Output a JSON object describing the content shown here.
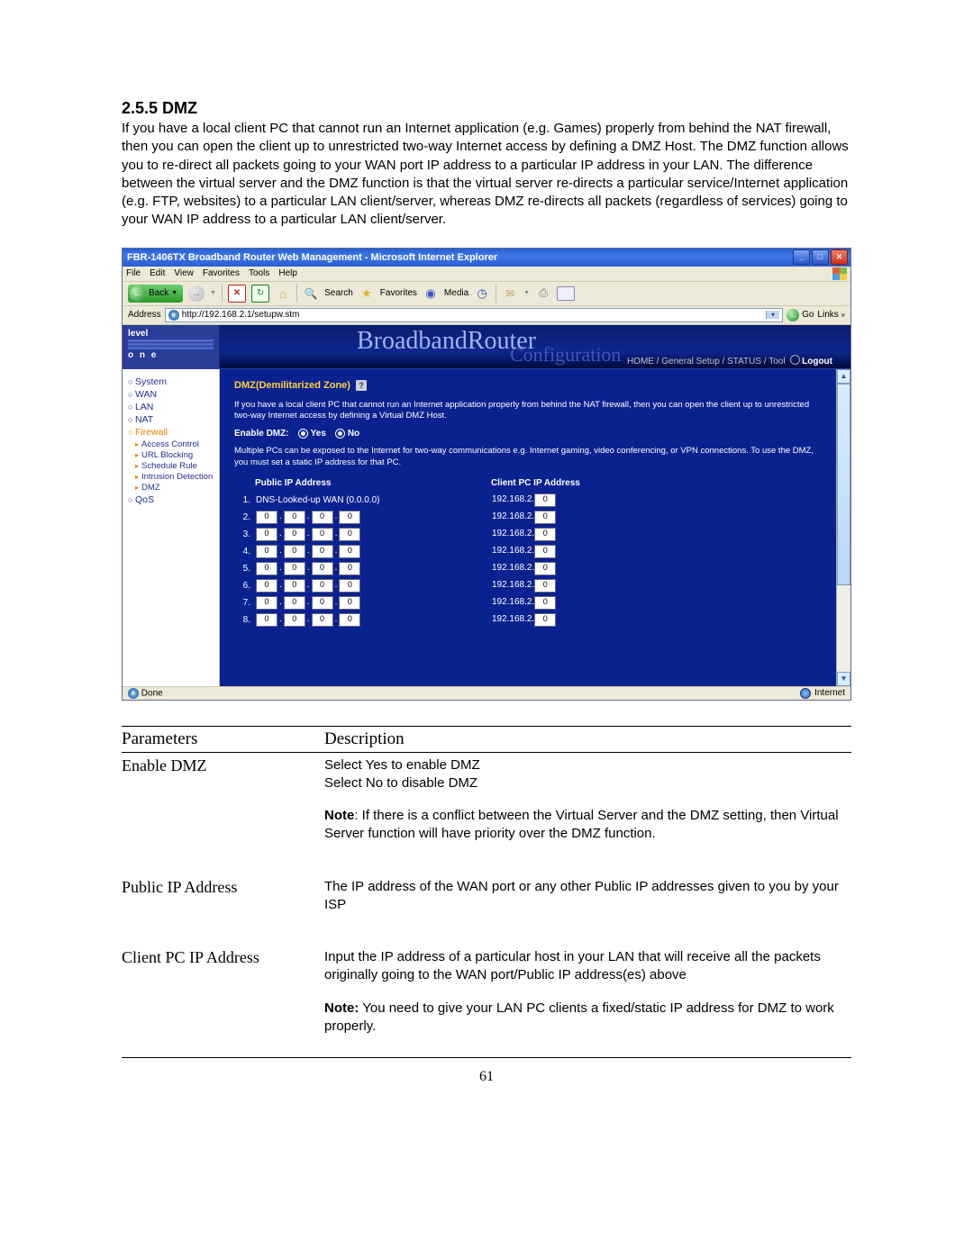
{
  "heading": "2.5.5 DMZ",
  "intro": "If you have a local client PC that cannot run an Internet application (e.g. Games) properly from behind the NAT firewall, then you can open the client up to unrestricted two-way Internet access by defining a DMZ Host. The DMZ function allows you to re-direct all packets going to your WAN port IP address to a particular IP address in your LAN. The difference between the virtual server and the DMZ function is that the virtual server re-directs a particular service/Internet application (e.g. FTP, websites) to a particular LAN client/server, whereas DMZ re-directs all packets (regardless of services) going to your WAN IP address to a particular LAN client/server.",
  "browser": {
    "title": "FBR-1406TX Broadband Router Web Management - Microsoft Internet Explorer",
    "menus": [
      "File",
      "Edit",
      "View",
      "Favorites",
      "Tools",
      "Help"
    ],
    "toolbar": {
      "back": "Back",
      "search": "Search",
      "favorites": "Favorites",
      "media": "Media"
    },
    "address_label": "Address",
    "url": "http://192.168.2.1/setupw.stm",
    "go": "Go",
    "links": "Links",
    "status_done": "Done",
    "status_zone": "Internet"
  },
  "banner": {
    "logo_top": "level",
    "logo_bottom": "o n e",
    "title": "BroadbandRouter",
    "subtitle": "Configuration",
    "breadcrumb": "HOME / General Setup / STATUS / Tool",
    "logout": "Logout"
  },
  "sidebar": {
    "items": [
      {
        "label": "System"
      },
      {
        "label": "WAN"
      },
      {
        "label": "LAN"
      },
      {
        "label": "NAT"
      },
      {
        "label": "Firewall",
        "active": true
      },
      {
        "label": "QoS"
      }
    ],
    "sub": [
      "Access Control",
      "URL Blocking",
      "Schedule Rule",
      "Intrusion Detection",
      "DMZ"
    ]
  },
  "dmz": {
    "title": "DMZ(Demilitarized Zone)",
    "desc": "If you have a local client PC that cannot run an Internet application properly from behind the NAT firewall, then you can open the client up to unrestricted two-way Internet access by defining a Virtual DMZ Host.",
    "enable_label": "Enable DMZ:",
    "yes": "Yes",
    "no": "No",
    "note": "Multiple PCs can be exposed to the Internet for two-way communications e.g. Internet gaming, video conferencing, or VPN connections.  To use the DMZ, you must set a static IP address for that PC.",
    "th_public": "Public IP Address",
    "th_client": "Client PC IP Address",
    "row1_public": "DNS-Looked-up WAN (0.0.0.0)",
    "client_prefix": "192.168.2.",
    "client_last": "0",
    "rows": [
      {
        "n": "1.",
        "first": true
      },
      {
        "n": "2.",
        "oct": [
          "0",
          "0",
          "0",
          "0"
        ]
      },
      {
        "n": "3.",
        "oct": [
          "0",
          "0",
          "0",
          "0"
        ]
      },
      {
        "n": "4.",
        "oct": [
          "0",
          "0",
          "0",
          "0"
        ]
      },
      {
        "n": "5.",
        "oct": [
          "0",
          "0",
          "0",
          "0"
        ]
      },
      {
        "n": "6.",
        "oct": [
          "0",
          "0",
          "0",
          "0"
        ]
      },
      {
        "n": "7.",
        "oct": [
          "0",
          "0",
          "0",
          "0"
        ]
      },
      {
        "n": "8.",
        "oct": [
          "0",
          "0",
          "0",
          "0"
        ]
      }
    ]
  },
  "params": {
    "h1": "Parameters",
    "h2": "Description",
    "rows": [
      {
        "name": "Enable DMZ",
        "p1": "Select Yes to enable DMZ\nSelect No to disable DMZ",
        "p2_label": "Note",
        "p2": ": If there is a conflict between the Virtual Server and the DMZ setting, then Virtual Server function will have priority over the DMZ function."
      },
      {
        "name": "Public IP Address",
        "p1": "The IP address of the WAN port or any other Public IP addresses given to you by your ISP"
      },
      {
        "name": "Client PC IP Address",
        "p1": "Input the IP address of a particular host in your LAN that will receive all the packets originally going to the WAN port/Public IP address(es) above",
        "p2_label": "Note:",
        "p2": " You need to give your LAN PC clients a fixed/static IP address for DMZ to work properly."
      }
    ]
  },
  "pagenum": "61"
}
